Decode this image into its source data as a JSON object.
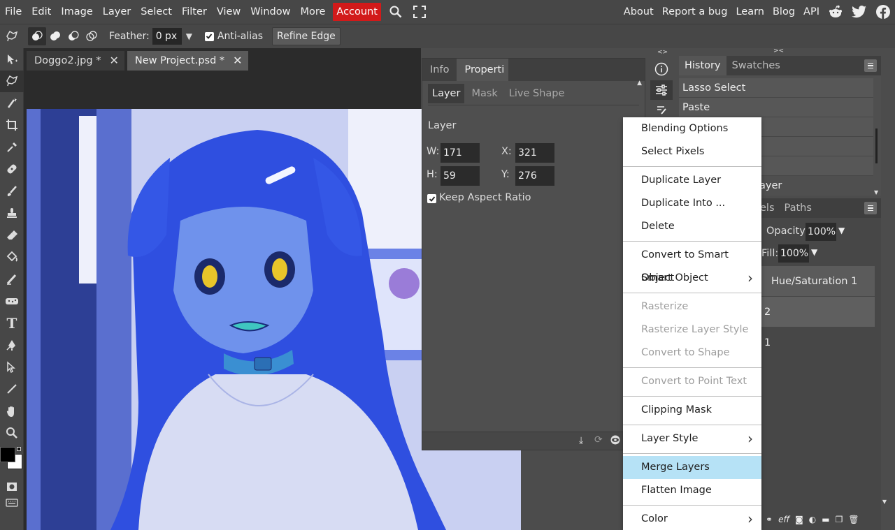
{
  "menubar": {
    "items": [
      "File",
      "Edit",
      "Image",
      "Layer",
      "Select",
      "Filter",
      "View",
      "Window",
      "More"
    ],
    "account_label": "Account",
    "right_links": [
      "About",
      "Report a bug",
      "Learn",
      "Blog",
      "API"
    ],
    "icons": [
      "search-icon",
      "fullscreen-icon",
      "reddit-icon",
      "twitter-icon",
      "facebook-icon"
    ]
  },
  "options": {
    "feather_label": "Feather:",
    "feather_value": "0 px",
    "antialias_label": "Anti-alias",
    "antialias_checked": true,
    "refine_label": "Refine Edge"
  },
  "documents": [
    {
      "name": "Doggo2.jpg *",
      "active": false
    },
    {
      "name": "New Project.psd *",
      "active": true
    }
  ],
  "properties": {
    "tabs": [
      "Info",
      "Properti"
    ],
    "active_tab": "Properti",
    "subtabs": [
      "Layer",
      "Mask",
      "Live Shape"
    ],
    "section": "Layer",
    "w_label": "W:",
    "w_value": "171",
    "x_label": "X:",
    "x_value": "321",
    "h_label": "H:",
    "h_value": "59",
    "y_label": "Y:",
    "y_value": "276",
    "keep_aspect_label": "Keep Aspect Ratio",
    "keep_aspect_checked": true
  },
  "history": {
    "tabs": [
      "History",
      "Swatches"
    ],
    "rows": [
      "Lasso Select",
      "Paste",
      "",
      "",
      "",
      "ayer"
    ]
  },
  "layers": {
    "tabs_visible": [
      "els",
      "Paths"
    ],
    "opacity_label": "Opacity:",
    "opacity_value": "100%",
    "fill_label": "Fill:",
    "fill_value": "100%",
    "rows": [
      "Hue/Saturation 1",
      "2",
      "1"
    ]
  },
  "context_menu": {
    "groups": [
      [
        {
          "label": "Blending Options"
        },
        {
          "label": "Select Pixels"
        }
      ],
      [
        {
          "label": "Duplicate Layer"
        },
        {
          "label": "Duplicate Into ..."
        },
        {
          "label": "Delete"
        }
      ],
      [
        {
          "label": "Convert to Smart Object"
        },
        {
          "label": "Smart Object",
          "submenu": true
        }
      ],
      [
        {
          "label": "Rasterize",
          "disabled": true
        },
        {
          "label": "Rasterize Layer Style",
          "disabled": true
        },
        {
          "label": "Convert to Shape",
          "disabled": true
        }
      ],
      [
        {
          "label": "Convert to Point Text",
          "disabled": true
        }
      ],
      [
        {
          "label": "Clipping Mask"
        }
      ],
      [
        {
          "label": "Layer Style",
          "submenu": true
        }
      ],
      [
        {
          "label": "Merge Layers",
          "hover": true
        },
        {
          "label": "Flatten Image"
        }
      ],
      [
        {
          "label": "Color",
          "submenu": true
        }
      ]
    ]
  },
  "colors": {
    "accent_account": "#d21a1a",
    "menu_hover": "#b6e2f6",
    "foreground": "#000000",
    "background": "#ffffff"
  }
}
